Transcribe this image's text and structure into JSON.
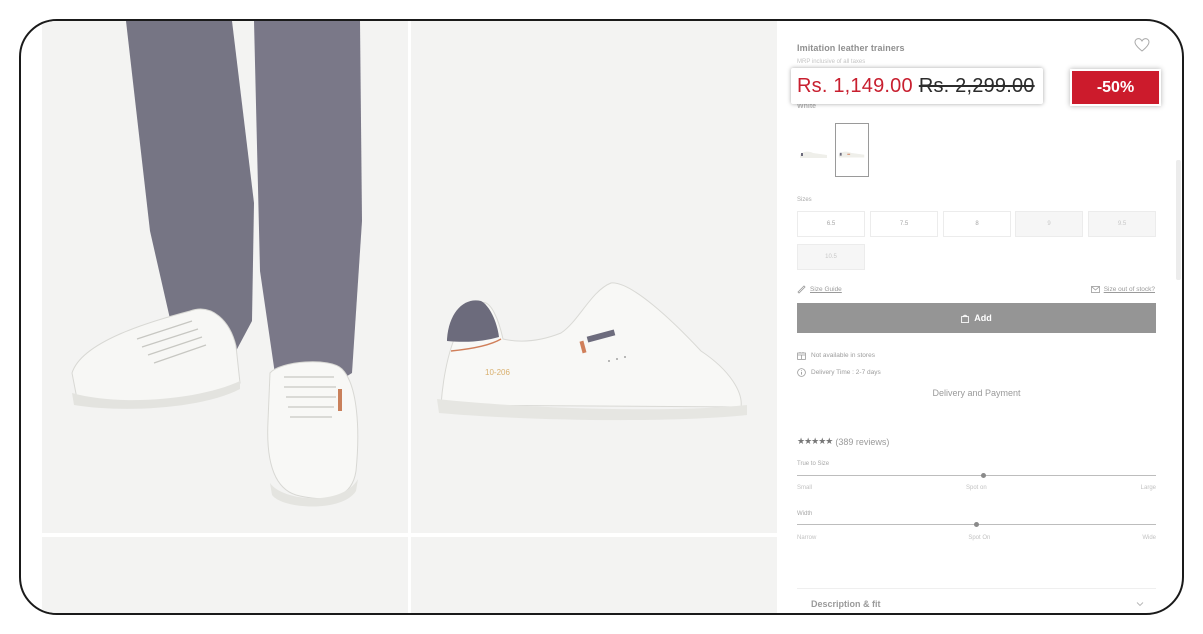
{
  "product": {
    "title": "Imitation leather trainers",
    "taxes_note": "MRP inclusive of all taxes",
    "price_current": "Rs. 1,149.00",
    "price_original": "Rs. 2,299.00",
    "discount": "-50%",
    "color_name": "White",
    "heel_code": "10-206"
  },
  "sizes": {
    "label": "Sizes",
    "options": [
      {
        "label": "6.5",
        "available": true
      },
      {
        "label": "7.5",
        "available": true
      },
      {
        "label": "8",
        "available": true
      },
      {
        "label": "9",
        "available": false
      },
      {
        "label": "9.5",
        "available": false
      },
      {
        "label": "10.5",
        "available": false
      }
    ]
  },
  "links": {
    "size_guide": "Size Guide",
    "size_out_of_stock": "Size out of stock?"
  },
  "cart": {
    "add_label": "Add"
  },
  "availability": {
    "stores": "Not available in stores",
    "delivery_time": "Delivery Time : 2-7 days",
    "delivery_and_payment": "Delivery and Payment"
  },
  "reviews": {
    "stars": "★★★★★",
    "rating": 4.5,
    "count_text": "(389 reviews)"
  },
  "fit": {
    "true_to_size": {
      "label": "True to Size",
      "left": "Small",
      "middle": "Spot on",
      "right": "Large",
      "position": 0.52
    },
    "width": {
      "label": "Width",
      "left": "Narrow",
      "middle": "Spot On",
      "right": "Wide",
      "position": 0.5
    }
  },
  "accordion": {
    "description_label": "Description & fit"
  },
  "icons": [
    "heart-icon",
    "ruler-icon",
    "mail-icon",
    "bag-icon",
    "store-icon",
    "info-icon",
    "star-icon",
    "chevron-down-icon"
  ],
  "colors": {
    "price_red": "#c81f2f",
    "discount_bg": "#cc1b2c",
    "add_button": "#959595"
  }
}
